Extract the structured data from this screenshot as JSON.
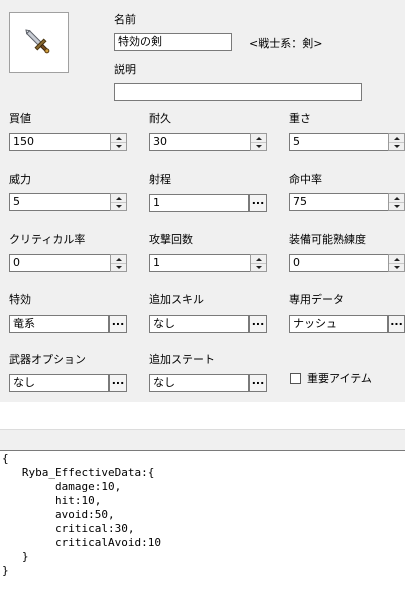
{
  "header": {
    "name_label": "名前",
    "name_value": "特効の剣",
    "type_text": "<戦士系：剣>",
    "desc_label": "説明",
    "desc_value": ""
  },
  "stats": {
    "price": {
      "label": "買値",
      "value": "150"
    },
    "durability": {
      "label": "耐久",
      "value": "30"
    },
    "weight": {
      "label": "重さ",
      "value": "5"
    },
    "power": {
      "label": "威力",
      "value": "5"
    },
    "range": {
      "label": "射程",
      "value": "1"
    },
    "hit": {
      "label": "命中率",
      "value": "75"
    },
    "critical": {
      "label": "クリティカル率",
      "value": "0"
    },
    "attack_count": {
      "label": "攻撃回数",
      "value": "1"
    },
    "mastery": {
      "label": "装備可能熟練度",
      "value": "0"
    },
    "effective": {
      "label": "特効",
      "value": "竜系"
    },
    "extra_skill": {
      "label": "追加スキル",
      "value": "なし"
    },
    "exclusive_data": {
      "label": "専用データ",
      "value": "ナッシュ"
    },
    "weapon_option": {
      "label": "武器オプション",
      "value": "なし"
    },
    "extra_state": {
      "label": "追加ステート",
      "value": "なし"
    }
  },
  "important_item": {
    "label": "重要アイテム",
    "checked": false
  },
  "dots_label": "...",
  "code": "{\n   Ryba_EffectiveData:{\n        damage:10,\n        hit:10,\n        avoid:50,\n        critical:30,\n        criticalAvoid:10\n   }\n}"
}
